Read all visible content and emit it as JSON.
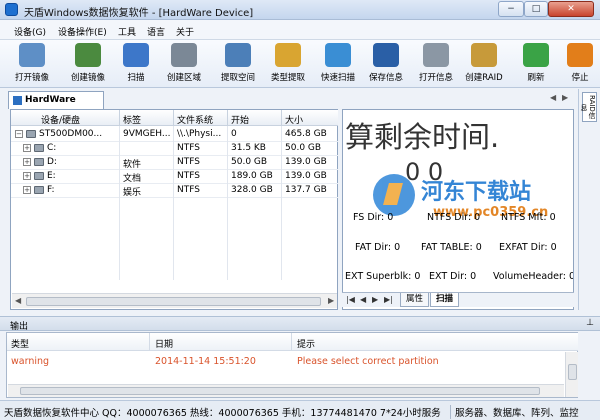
{
  "window": {
    "title": "天盾Windows数据恢复软件 - [HardWare Device]",
    "min": "−",
    "max": "□",
    "close": "✕"
  },
  "menu": [
    "设备(G)",
    "设备操作(E)",
    "工具",
    "语言",
    "关于"
  ],
  "toolbar": [
    {
      "label": "打开镜像",
      "icon": "disk-image-icon",
      "color": "#5e8fc6"
    },
    {
      "label": "创建镜像",
      "icon": "monitor-icon",
      "color": "#4b8a3f"
    },
    {
      "label": "扫描",
      "icon": "scan-icon",
      "color": "#3d77c9"
    },
    {
      "label": "创建区域",
      "icon": "region-icon",
      "color": "#7b8896"
    },
    {
      "label": "提取空间",
      "icon": "extract-space-icon",
      "color": "#4c7fb8"
    },
    {
      "label": "类型提取",
      "icon": "notepad-icon",
      "color": "#d9a531"
    },
    {
      "label": "快速扫描",
      "icon": "quick-scan-icon",
      "color": "#3a8ed4"
    },
    {
      "label": "保存信息",
      "icon": "save-icon",
      "color": "#2a5fa6"
    },
    {
      "label": "打开信息",
      "icon": "open-info-icon",
      "color": "#8b97a4"
    },
    {
      "label": "创建RAID",
      "icon": "raid-icon",
      "color": "#c79a3a"
    },
    {
      "label": "刷新",
      "icon": "refresh-icon",
      "color": "#3aa346"
    },
    {
      "label": "停止",
      "icon": "stop-icon",
      "color": "#e27e1a"
    }
  ],
  "tabs": {
    "main": "HardWare Device",
    "side": "RAID信息"
  },
  "device_table": {
    "columns": [
      "设备/硬盘",
      "标签",
      "文件系统",
      "开始",
      "大小"
    ],
    "rows": [
      {
        "device": "ST500DM00...",
        "label": "9VMGEH...",
        "fs": "\\\\.\\Physi...",
        "start": "0",
        "size": "465.8 GB"
      },
      {
        "device": "C:",
        "label": "",
        "fs": "NTFS",
        "start": "31.5 KB",
        "size": "50.0 GB"
      },
      {
        "device": "D:",
        "label": "软件",
        "fs": "NTFS",
        "start": "50.0 GB",
        "size": "139.0 GB"
      },
      {
        "device": "E:",
        "label": "文档",
        "fs": "NTFS",
        "start": "189.0 GB",
        "size": "139.0 GB"
      },
      {
        "device": "F:",
        "label": "娱乐",
        "fs": "NTFS",
        "start": "328.0 GB",
        "size": "137.7 GB"
      }
    ]
  },
  "scan_panel": {
    "big_text": "算剩余时间.",
    "big_value": "0 0",
    "lines": [
      "FS Dir: 0",
      "NTFS Dir: 0",
      "NTFS Mft: 0",
      "FAT Dir: 0",
      "FAT TABLE: 0",
      "EXFAT Dir: 0",
      "EXT Superblk: 0",
      "EXT Dir: 0",
      "VolumeHeader: 0"
    ],
    "tabs": [
      "属性",
      "扫描"
    ]
  },
  "watermark": {
    "name": "河东下载站",
    "url": "www.pc0359.cn"
  },
  "output": {
    "title": "输出",
    "columns": [
      "类型",
      "日期",
      "提示"
    ],
    "rows": [
      {
        "type": "warning",
        "date": "2014-11-14 15:51:20",
        "message": "Please select correct partition"
      }
    ]
  },
  "status": {
    "left": "天盾数据恢复软件中心 QQ：4000076365 热线：4000076365 手机：13774481470  7*24小时服务",
    "right": "服务器、数据库、阵列、监控"
  }
}
